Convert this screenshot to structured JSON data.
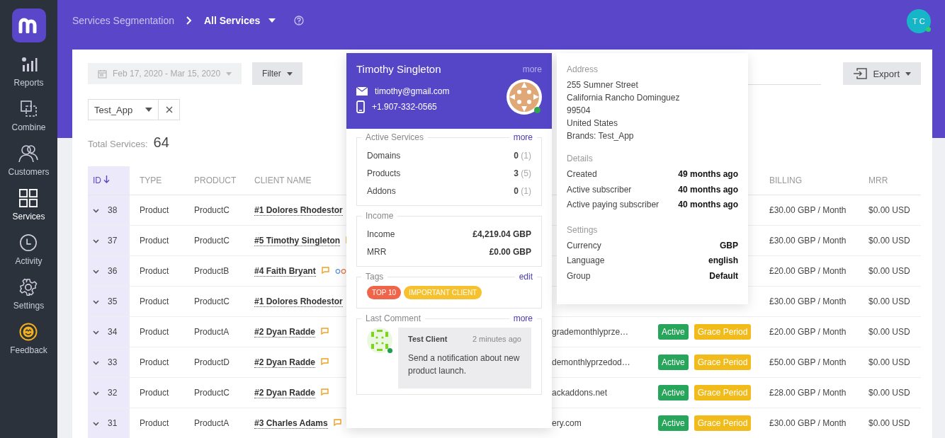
{
  "sidebar": {
    "items": [
      {
        "label": "Reports",
        "kind": "bars",
        "selected": false
      },
      {
        "label": "Combine",
        "kind": "combine",
        "selected": false
      },
      {
        "label": "Customers",
        "kind": "people",
        "selected": false
      },
      {
        "label": "Services",
        "kind": "grid",
        "selected": true
      },
      {
        "label": "Activity",
        "kind": "clock",
        "selected": false
      },
      {
        "label": "Settings",
        "kind": "gear",
        "selected": false
      },
      {
        "label": "Feedback",
        "kind": "smile",
        "selected": false
      }
    ]
  },
  "header": {
    "breadcrumb": [
      "Services Segmentation",
      "All Services"
    ],
    "avatar": "T C",
    "avatar_online": true
  },
  "toolbar": {
    "date_range": "Feb 17, 2020 - Mar 15, 2020",
    "filter": "Filter",
    "export": "Export",
    "brand_filter": "Test_App"
  },
  "total": {
    "label": "Total Services:",
    "value": "64"
  },
  "table": {
    "columns": [
      {
        "label": "ID",
        "sorted": true
      },
      {
        "label": "TYPE",
        "sorted": false
      },
      {
        "label": "PRODUCT",
        "sorted": false
      },
      {
        "label": "CLIENT NAME",
        "sorted": false
      },
      {
        "label": "BILLING",
        "sorted": false
      },
      {
        "label": "MRR",
        "sorted": false
      }
    ],
    "rows": [
      {
        "id": "38",
        "type": "Product",
        "product": "ProductC",
        "client": "#1 Dolores Rhodestor",
        "linked": false,
        "column_5": "",
        "statuses": [],
        "billing": "£30.00 GBP / Month",
        "mrr": "$0.00 USD"
      },
      {
        "id": "37",
        "type": "Product",
        "product": "ProductC",
        "client": "#5 Timothy Singleton",
        "linked": false,
        "column_5": "",
        "statuses": [],
        "billing": "£30.00 GBP / Month",
        "mrr": "$0.00 USD"
      },
      {
        "id": "36",
        "type": "Product",
        "product": "ProductB",
        "client": "#4 Faith Bryant",
        "linked": true,
        "column_5": "",
        "statuses": [],
        "billing": "£20.00 GBP / Month",
        "mrr": "$0.00 USD"
      },
      {
        "id": "35",
        "type": "Product",
        "product": "ProductC",
        "client": "#1 Dolores Rhodestor",
        "linked": false,
        "column_5": "",
        "statuses": [],
        "billing": "£30.00 GBP / Month",
        "mrr": "$0.00 USD"
      },
      {
        "id": "34",
        "type": "Product",
        "product": "ProductA",
        "client": "#2 Dyan Radde",
        "linked": false,
        "column_5": "grademonthlyprze…",
        "statuses": [
          {
            "label": "Active",
            "color": "#27a55a"
          },
          {
            "label": "Grace Period",
            "color": "#f2bb1c"
          }
        ],
        "billing": "£20.00 GBP / Month",
        "mrr": "$0.00 USD"
      },
      {
        "id": "33",
        "type": "Product",
        "product": "ProductD",
        "client": "#2 Dyan Radde",
        "linked": false,
        "column_5": "demonthlyprzedod…",
        "statuses": [
          {
            "label": "Active",
            "color": "#27a55a"
          },
          {
            "label": "Grace Period",
            "color": "#f2bb1c"
          }
        ],
        "billing": "£50.00 GBP / Month",
        "mrr": "$0.00 USD"
      },
      {
        "id": "32",
        "type": "Product",
        "product": "ProductC",
        "client": "#2 Dyan Radde",
        "linked": false,
        "column_5": "ackaddons.net",
        "statuses": [
          {
            "label": "Active",
            "color": "#27a55a"
          },
          {
            "label": "Grace Period",
            "color": "#f2bb1c"
          }
        ],
        "billing": "£28.00 GBP / Month",
        "mrr": "$0.00 USD"
      },
      {
        "id": "31",
        "type": "Product",
        "product": "ProductA",
        "client": "#3 Charles Adams",
        "linked": false,
        "column_5": "ery.com",
        "statuses": [
          {
            "label": "Active",
            "color": "#27a55a"
          },
          {
            "label": "Grace Period",
            "color": "#f2bb1c"
          }
        ],
        "billing": "£30.00 GBP / Month",
        "mrr": "$0.00 USD"
      }
    ]
  },
  "client_card": {
    "name": "Timothy Singleton",
    "more": "more",
    "email": "timothy@gmail.com",
    "phone": "+1.907-332-0565",
    "online": true,
    "active_services": {
      "title": "Active Services",
      "more": "more",
      "items": [
        {
          "label": "Domains",
          "count": "0",
          "total": "(1)"
        },
        {
          "label": "Products",
          "count": "3",
          "total": "(5)"
        },
        {
          "label": "Addons",
          "count": "0",
          "total": "(1)"
        }
      ]
    },
    "income": {
      "title": "Income",
      "items": [
        {
          "label": "Income",
          "value": "£4,219.04 GBP"
        },
        {
          "label": "MRR",
          "value": "£0.00 GBP"
        }
      ]
    },
    "tags": {
      "title": "Tags",
      "edit": "edit",
      "items": [
        {
          "label": "TOP 10",
          "color": "#f0654a"
        },
        {
          "label": "IMPORTANT CLIENT",
          "color": "#f5c12e"
        }
      ]
    },
    "last_comment": {
      "title": "Last Comment",
      "more": "more",
      "author": "Test Client",
      "time": "2 minutes ago",
      "text": "Send a notification about new product launch.",
      "online": true
    }
  },
  "details_card": {
    "sections": [
      {
        "title": "Address",
        "kind": "lines",
        "lines": [
          "255 Sumner Street",
          "California Rancho Dominguez",
          "99504",
          "United States",
          "Brands: Test_App"
        ]
      },
      {
        "title": "Details",
        "kind": "pairs",
        "items": [
          {
            "label": "Created",
            "value": "49 months ago"
          },
          {
            "label": "Active subscriber",
            "value": "40 months ago"
          },
          {
            "label": "Active paying subscriber",
            "value": "40 months ago"
          }
        ]
      },
      {
        "title": "Settings",
        "kind": "pairs",
        "items": [
          {
            "label": "Currency",
            "value": "GBP"
          },
          {
            "label": "Language",
            "value": "english"
          },
          {
            "label": "Group",
            "value": "Default"
          }
        ]
      }
    ]
  }
}
